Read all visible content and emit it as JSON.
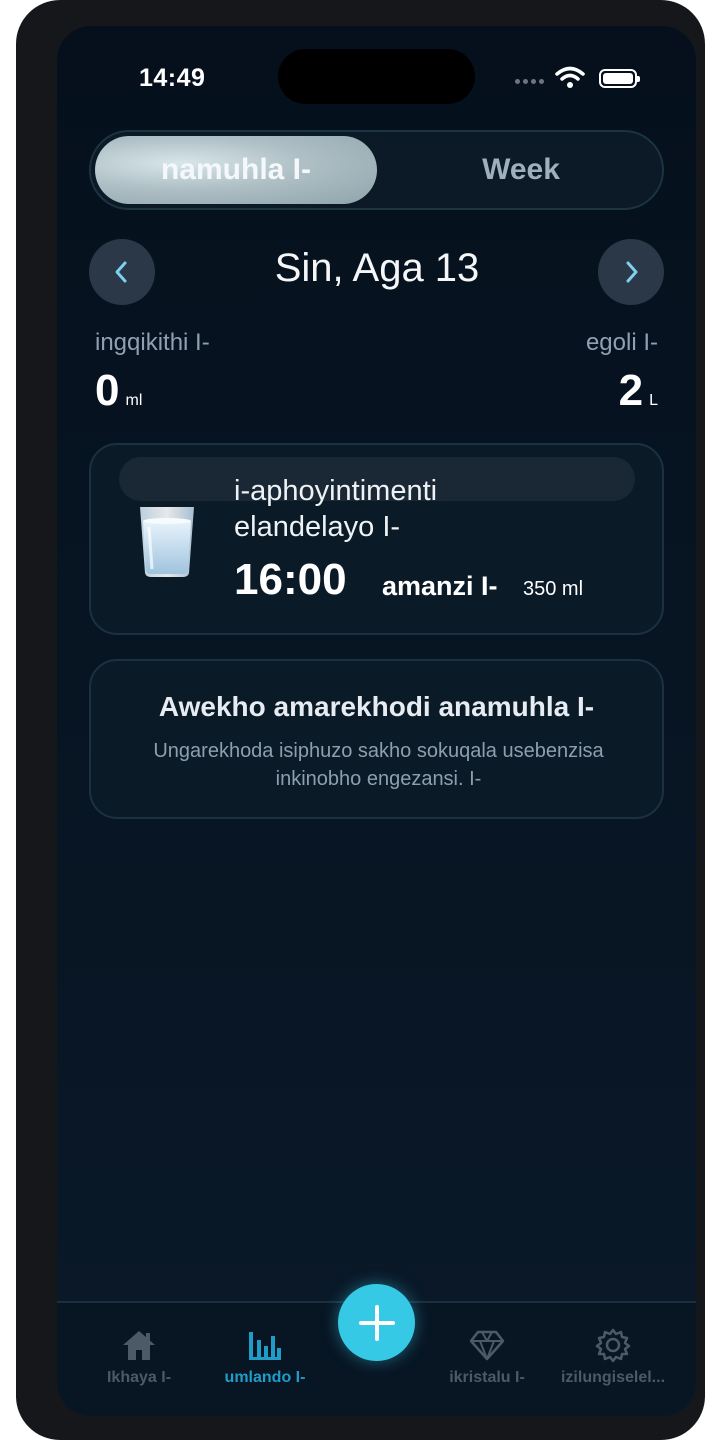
{
  "status_bar": {
    "time": "14:49"
  },
  "segmented": {
    "day_label": "namuhla I-",
    "week_label": "Week"
  },
  "date_nav": {
    "title": "Sin, Aga 13"
  },
  "stats": {
    "total_label": "ingqikithi I-",
    "total_value": "0",
    "total_unit": "ml",
    "goal_label": "egoli I-",
    "goal_value": "2",
    "goal_unit": "L"
  },
  "next_appointment": {
    "title": "i-aphoyintimenti elandelayo I-",
    "time": "16:00",
    "drink": "amanzi I-",
    "amount": "350 ml"
  },
  "empty_state": {
    "title": "Awekho amarekhodi anamuhla I-",
    "message": "Ungarekhoda isiphuzo sakho sokuqala usebenzisa inkinobho engezansi. I-"
  },
  "tab_bar": {
    "home": "Ikhaya I-",
    "history": "umlando I-",
    "crystal": "ikristalu I-",
    "settings": "izilungiselel..."
  },
  "colors": {
    "accent": "#36c9e6",
    "active_tab": "#1f9cc8",
    "background": "#07131f"
  }
}
